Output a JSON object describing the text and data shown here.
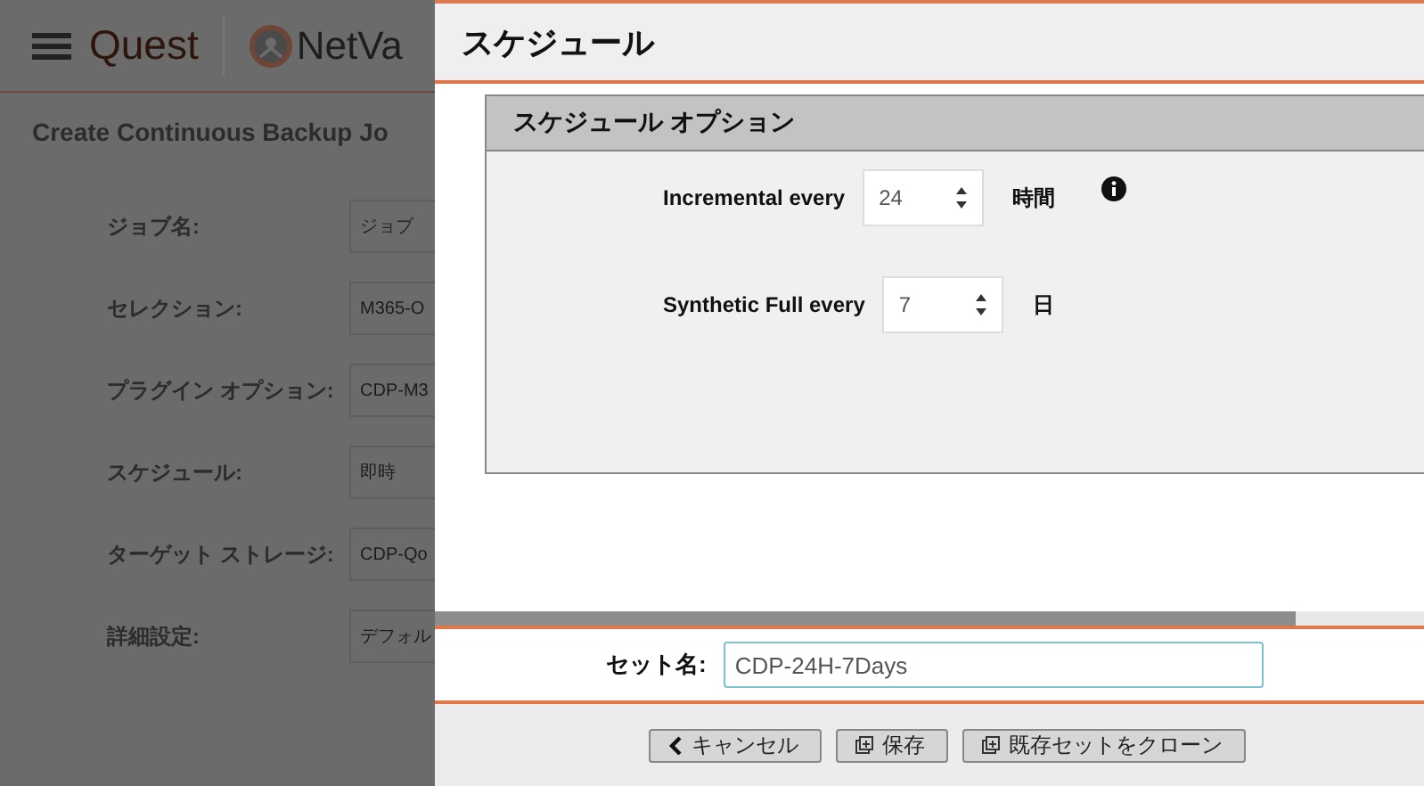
{
  "background_page": {
    "header": {
      "logo_text": "Quest",
      "product_text": "NetVa"
    },
    "title": "Create Continuous Backup Jo",
    "fields": [
      {
        "label": "ジョブ名:",
        "placeholder": "ジョブ"
      },
      {
        "label": "セレクション:",
        "value": "M365-O"
      },
      {
        "label": "プラグイン オプション:",
        "value": "CDP-M3"
      },
      {
        "label": "スケジュール:",
        "value": "即時"
      },
      {
        "label": "ターゲット ストレージ:",
        "value": "CDP-Qo"
      },
      {
        "label": "詳細設定:",
        "value": "デフォル"
      }
    ]
  },
  "dialog": {
    "title": "スケジュール",
    "section": {
      "title": "スケジュール オプション",
      "rows": [
        {
          "label": "Incremental every",
          "value": "24",
          "unit": "時間",
          "info": true
        },
        {
          "label": "Synthetic Full every",
          "value": "7",
          "unit": "日",
          "info": false
        }
      ]
    },
    "set_name": {
      "label": "セット名:",
      "value": "CDP-24H-7Days"
    },
    "buttons": [
      {
        "label": "キャンセル",
        "kind": "back"
      },
      {
        "label": "保存",
        "kind": "copy"
      },
      {
        "label": "既存セットをクローン",
        "kind": "copy"
      }
    ]
  }
}
